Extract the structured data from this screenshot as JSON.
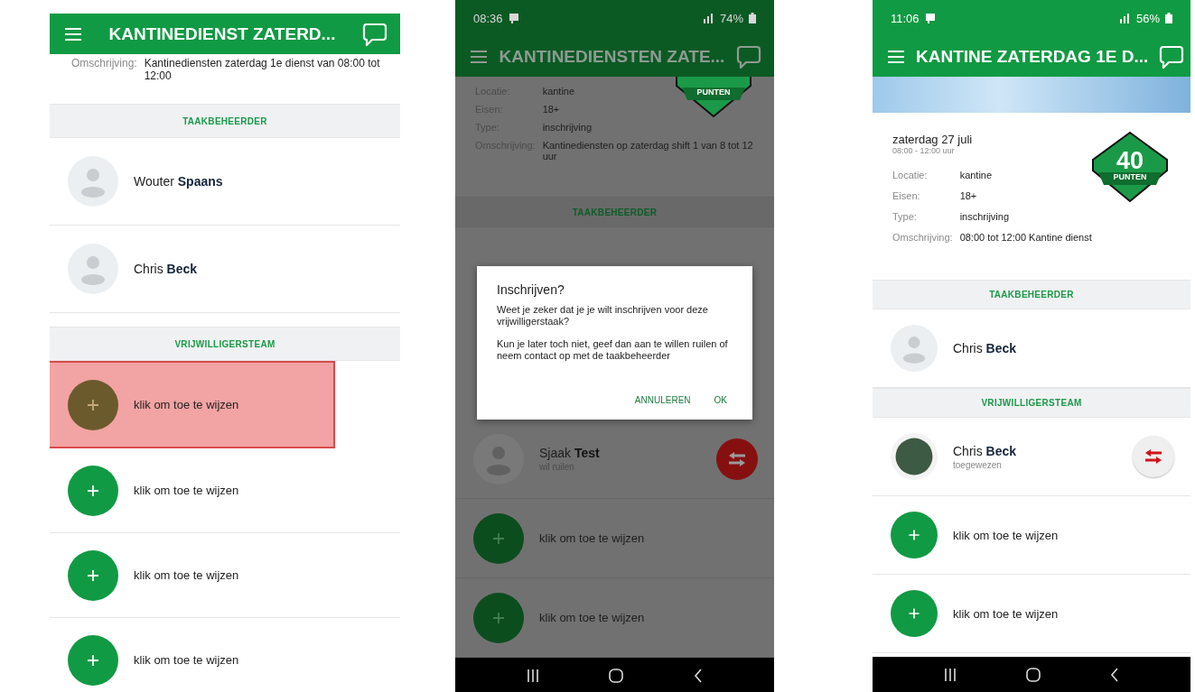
{
  "screens": [
    {
      "dimmed": false,
      "app_bar": {
        "title": "KANTINEDIENST ZATERD..."
      },
      "nav_bar": false,
      "body": [
        {
          "kind": "details",
          "rows": [
            {
              "label": "Omschrijving:",
              "value": "Kantinediensten zaterdag 1e dienst van 08:00 tot 12:00"
            }
          ]
        },
        {
          "kind": "section",
          "title": "TAAKBEHEERDER"
        },
        {
          "kind": "person",
          "name": "Wouter **Spaans**",
          "avatar": {
            "kind": "placeholder"
          }
        },
        {
          "kind": "person",
          "name": "Chris **Beck**",
          "avatar": {
            "kind": "placeholder"
          }
        },
        {
          "kind": "section",
          "title": "VRIJWILLIGERSTEAM"
        },
        {
          "kind": "slot",
          "label": "klik om toe te wijzen",
          "highlighted": true
        },
        {
          "kind": "slot",
          "label": "klik om toe te wijzen",
          "highlighted": false
        },
        {
          "kind": "slot",
          "label": "klik om toe te wijzen",
          "highlighted": false
        },
        {
          "kind": "slot",
          "label": "klik om toe te wijzen",
          "highlighted": false
        }
      ]
    },
    {
      "dimmed": true,
      "status_bar": {
        "time": "08:36",
        "battery": "74%"
      },
      "app_bar": {
        "title": "KANTINEDIENSTEN ZATE..."
      },
      "nav_bar": true,
      "body": [
        {
          "kind": "details",
          "badge": {
            "label": "PUNTEN"
          },
          "rows": [
            {
              "label": "Locatie:",
              "value": "kantine"
            },
            {
              "label": "Eisen:",
              "value": "18+"
            },
            {
              "label": "Type:",
              "value": "inschrijving"
            },
            {
              "label": "Omschrijving:",
              "value": "Kantinediensten op zaterdag shift 1 van 8 tot 12 uur"
            }
          ]
        },
        {
          "kind": "section",
          "title": "TAAKBEHEERDER"
        },
        {
          "kind": "dialog",
          "title": "Inschrijven?",
          "paragraphs": [
            "Weet je zeker dat je je wilt inschrijven voor deze vrijwilligerstaak?",
            "Kun je later toch niet, geef dan aan te willen ruilen of neem contact op met de taakbeheerder"
          ],
          "buttons": [
            "ANNULEREN",
            "OK"
          ]
        },
        {
          "kind": "person",
          "name": "Sjaak **Test**",
          "status": "wil ruilen",
          "avatar": {
            "kind": "placeholder"
          },
          "swap": {
            "kind": "filled"
          }
        },
        {
          "kind": "slot",
          "label": "klik om toe te wijzen",
          "highlighted": false
        },
        {
          "kind": "slot",
          "label": "klik om toe te wijzen",
          "highlighted": false
        }
      ]
    },
    {
      "dimmed": false,
      "status_bar": {
        "time": "11:06",
        "battery": "56%"
      },
      "app_bar": {
        "title": "KANTINE ZATERDAG 1E D..."
      },
      "nav_bar": true,
      "body": [
        {
          "kind": "banner"
        },
        {
          "kind": "details",
          "date": "zaterdag 27 juli",
          "time": "08:00 - 12:00 uur",
          "badge": {
            "number": "40",
            "label": "PUNTEN"
          },
          "rows": [
            {
              "label": "Locatie:",
              "value": "kantine"
            },
            {
              "label": "Eisen:",
              "value": "18+"
            },
            {
              "label": "Type:",
              "value": "inschrijving"
            },
            {
              "label": "Omschrijving:",
              "value": "08:00 tot 12:00 Kantine dienst"
            }
          ]
        },
        {
          "kind": "section",
          "title": "TAAKBEHEERDER"
        },
        {
          "kind": "person",
          "name": "Chris **Beck**",
          "avatar": {
            "kind": "placeholder"
          }
        },
        {
          "kind": "section",
          "title": "VRIJWILLIGERSTEAM"
        },
        {
          "kind": "person",
          "name": "Chris **Beck**",
          "status": "toegewezen",
          "avatar": {
            "kind": "photo"
          },
          "swap": {
            "kind": "light"
          }
        },
        {
          "kind": "slot",
          "label": "klik om toe te wijzen",
          "highlighted": false
        },
        {
          "kind": "slot",
          "label": "klik om toe te wijzen",
          "highlighted": false
        }
      ]
    }
  ]
}
